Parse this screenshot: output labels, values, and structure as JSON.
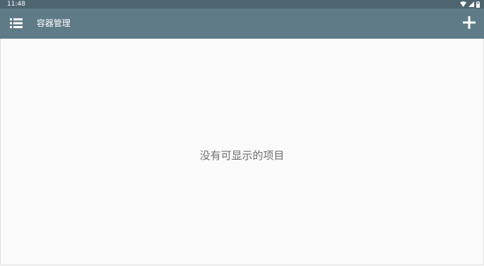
{
  "status_bar": {
    "time": "11:48",
    "icons": [
      "wifi-icon",
      "signal-icon",
      "battery-icon"
    ]
  },
  "app_bar": {
    "menu_icon": "menu-list-icon",
    "title": "容器管理",
    "add_icon": "plus-icon",
    "color": "#5f7b88"
  },
  "content": {
    "empty_message": "没有可显示的项目"
  },
  "colors": {
    "status_bar": "#4e6570",
    "app_bar": "#5f7b88",
    "background": "#fafafa",
    "empty_text": "#6f6f6f"
  }
}
